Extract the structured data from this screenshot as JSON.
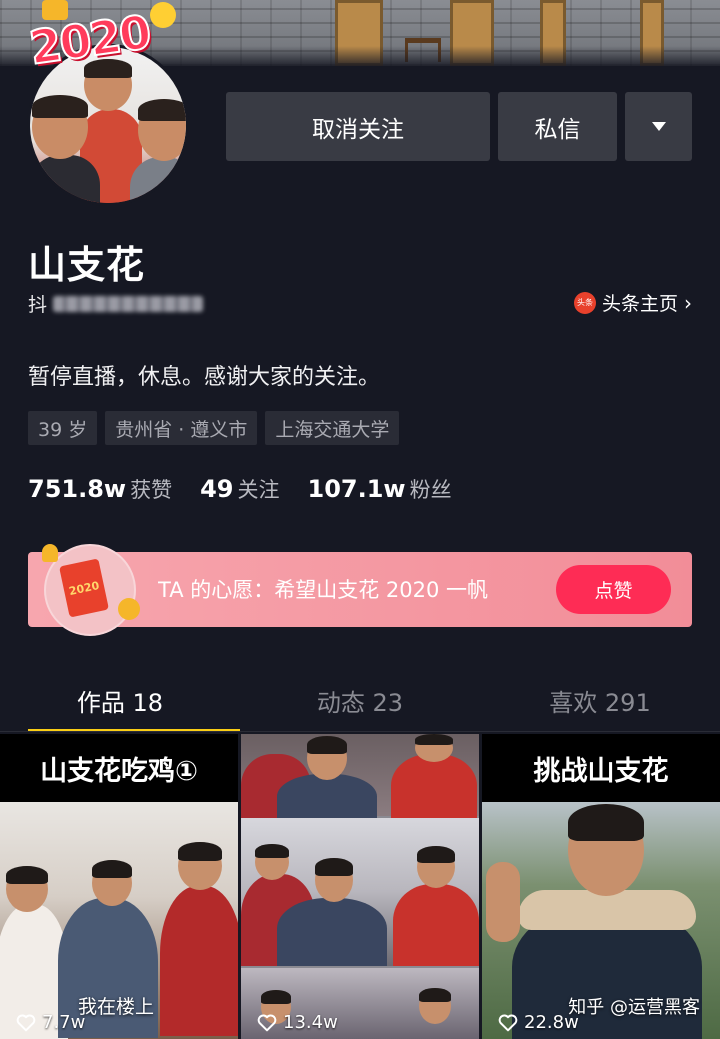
{
  "profile": {
    "name": "山支花",
    "douyin_prefix": "抖",
    "toutiao_link": "头条主页",
    "toutiao_logo": "头条",
    "bio": "暂停直播，休息。感谢大家的关注。",
    "tags": [
      "39 岁",
      "贵州省 · 遵义市",
      "上海交通大学"
    ],
    "avatar_badge": "2020"
  },
  "actions": {
    "unfollow": "取消关注",
    "message": "私信",
    "more_icon": "triangle-down-icon"
  },
  "stats": {
    "likes_value": "751.8w",
    "likes_label": "获赞",
    "following_value": "49",
    "following_label": "关注",
    "followers_value": "107.1w",
    "followers_label": "粉丝"
  },
  "wish": {
    "text": "TA 的心愿：希望山支花 2020 一帆",
    "icon_text": "2020",
    "like_button": "点赞"
  },
  "tabs": [
    {
      "label": "作品 18",
      "active": true
    },
    {
      "label": "动态 23",
      "active": false
    },
    {
      "label": "喜欢 291",
      "active": false
    }
  ],
  "videos": [
    {
      "caption": "山支花吃鸡①",
      "subtitle": "我在楼上",
      "likes": "7.7w"
    },
    {
      "caption": "",
      "subtitle": "",
      "likes": "13.4w"
    },
    {
      "caption": "挑战山支花",
      "subtitle": "",
      "likes": "22.8w"
    }
  ],
  "watermark": "知乎 @运营黑客",
  "colors": {
    "background": "#161823",
    "accent_red": "#fe2c55",
    "tab_indicator": "#face15",
    "button_bg": "#393b44"
  }
}
